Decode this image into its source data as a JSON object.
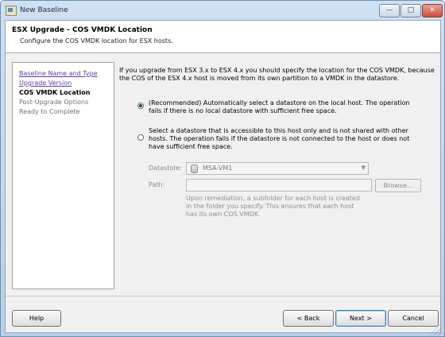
{
  "window": {
    "title": "New Baseline",
    "minimize_glyph": "—",
    "maximize_glyph": "□",
    "close_glyph": "✕"
  },
  "header": {
    "title": "ESX Upgrade - COS VMDK Location",
    "subtitle": "Configure the COS VMDK location for ESX hosts."
  },
  "nav": {
    "items": [
      {
        "label": "Baseline Name and Type",
        "state": "completed"
      },
      {
        "label": "Upgrade Version",
        "state": "completed"
      },
      {
        "label": "COS VMDK Location",
        "state": "current"
      },
      {
        "label": "Post-Upgrade Options",
        "state": "pending"
      },
      {
        "label": "Ready to Complete",
        "state": "pending"
      }
    ]
  },
  "content": {
    "description": "If you upgrade from ESX 3.x to ESX 4.x you should specify the location for the COS VMDK, because the COS of the ESX 4.x host is moved from its own partition to a VMDK in the datastore.",
    "option_auto": {
      "label": "(Recommended) Automatically select a datastore on the local host. The operation fails if there is no local datastore with sufficient free space.",
      "selected": true
    },
    "option_manual": {
      "label": "Select a datastore that is accessible to this host only and is not shared with other hosts. The operation fails if the datastore is not connected to the host or does not have sufficient free space.",
      "selected": false
    },
    "datastore_label": "Datastore:",
    "datastore_value": "MSA-VM1",
    "path_label": "Path:",
    "path_value": "",
    "browse_label": "Browse...",
    "hint": "Upon remediation, a subfolder for each host is created in the folder you specify. This ensures that each host has its own COS VMDK."
  },
  "footer": {
    "help": "Help",
    "back": "< Back",
    "next": "Next >",
    "cancel": "Cancel"
  },
  "icons": {
    "app": "baseline-icon",
    "datastore": "datastore-icon",
    "dropdown": "chevron-down-icon",
    "resize": "resize-grip-icon"
  },
  "colors": {
    "link": "#5b3fa0",
    "disabled_text": "#8a8a8a",
    "title_bar": "#cfe0f3"
  }
}
